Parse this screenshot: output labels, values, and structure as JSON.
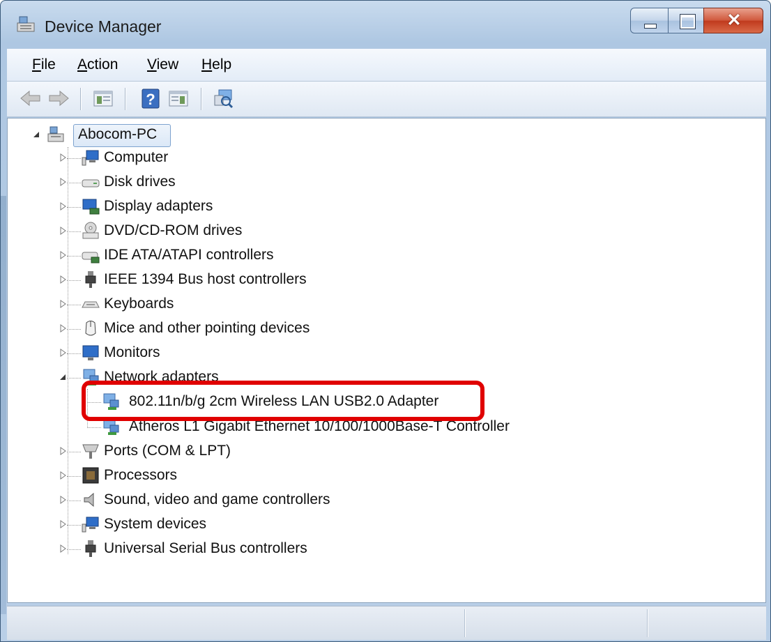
{
  "window": {
    "title": "Device Manager"
  },
  "menu": {
    "file": {
      "pre": "",
      "key": "F",
      "post": "ile"
    },
    "action": {
      "pre": "",
      "key": "A",
      "post": "ction"
    },
    "view": {
      "pre": "",
      "key": "V",
      "post": "iew"
    },
    "help": {
      "pre": "",
      "key": "H",
      "post": "elp"
    }
  },
  "toolbar": {
    "buttons": [
      "back-icon",
      "forward-icon",
      "show-hide-console-tree-icon",
      "help-icon",
      "show-hide-action-pane-icon",
      "scan-hardware-icon"
    ]
  },
  "tree": {
    "root": "Abocom-PC",
    "categories": [
      {
        "label": "Computer",
        "icon": "computer-icon",
        "expanded": false
      },
      {
        "label": "Disk drives",
        "icon": "disk-drive-icon",
        "expanded": false
      },
      {
        "label": "Display adapters",
        "icon": "display-adapter-icon",
        "expanded": false
      },
      {
        "label": "DVD/CD-ROM drives",
        "icon": "dvd-drive-icon",
        "expanded": false
      },
      {
        "label": "IDE ATA/ATAPI controllers",
        "icon": "ide-controller-icon",
        "expanded": false
      },
      {
        "label": "IEEE 1394 Bus host controllers",
        "icon": "ieee1394-icon",
        "expanded": false
      },
      {
        "label": "Keyboards",
        "icon": "keyboard-icon",
        "expanded": false
      },
      {
        "label": "Mice and other pointing devices",
        "icon": "mouse-icon",
        "expanded": false
      },
      {
        "label": "Monitors",
        "icon": "monitor-icon",
        "expanded": false
      },
      {
        "label": "Network adapters",
        "icon": "network-adapter-icon",
        "expanded": true,
        "children": [
          {
            "label": "802.11n/b/g 2cm Wireless LAN USB2.0 Adapter",
            "icon": "network-adapter-icon"
          },
          {
            "label": "Atheros L1 Gigabit Ethernet 10/100/1000Base-T Controller",
            "icon": "network-adapter-icon"
          }
        ]
      },
      {
        "label": "Ports (COM & LPT)",
        "icon": "port-icon",
        "expanded": false
      },
      {
        "label": "Processors",
        "icon": "processor-icon",
        "expanded": false
      },
      {
        "label": "Sound, video and game controllers",
        "icon": "speaker-icon",
        "expanded": false
      },
      {
        "label": "System devices",
        "icon": "system-device-icon",
        "expanded": false
      },
      {
        "label": "Universal Serial Bus controllers",
        "icon": "usb-icon",
        "expanded": false
      }
    ]
  },
  "colors": {
    "highlight_box": "#e00000",
    "title_bar": "#aec7e2",
    "close_button": "#c0391d"
  }
}
